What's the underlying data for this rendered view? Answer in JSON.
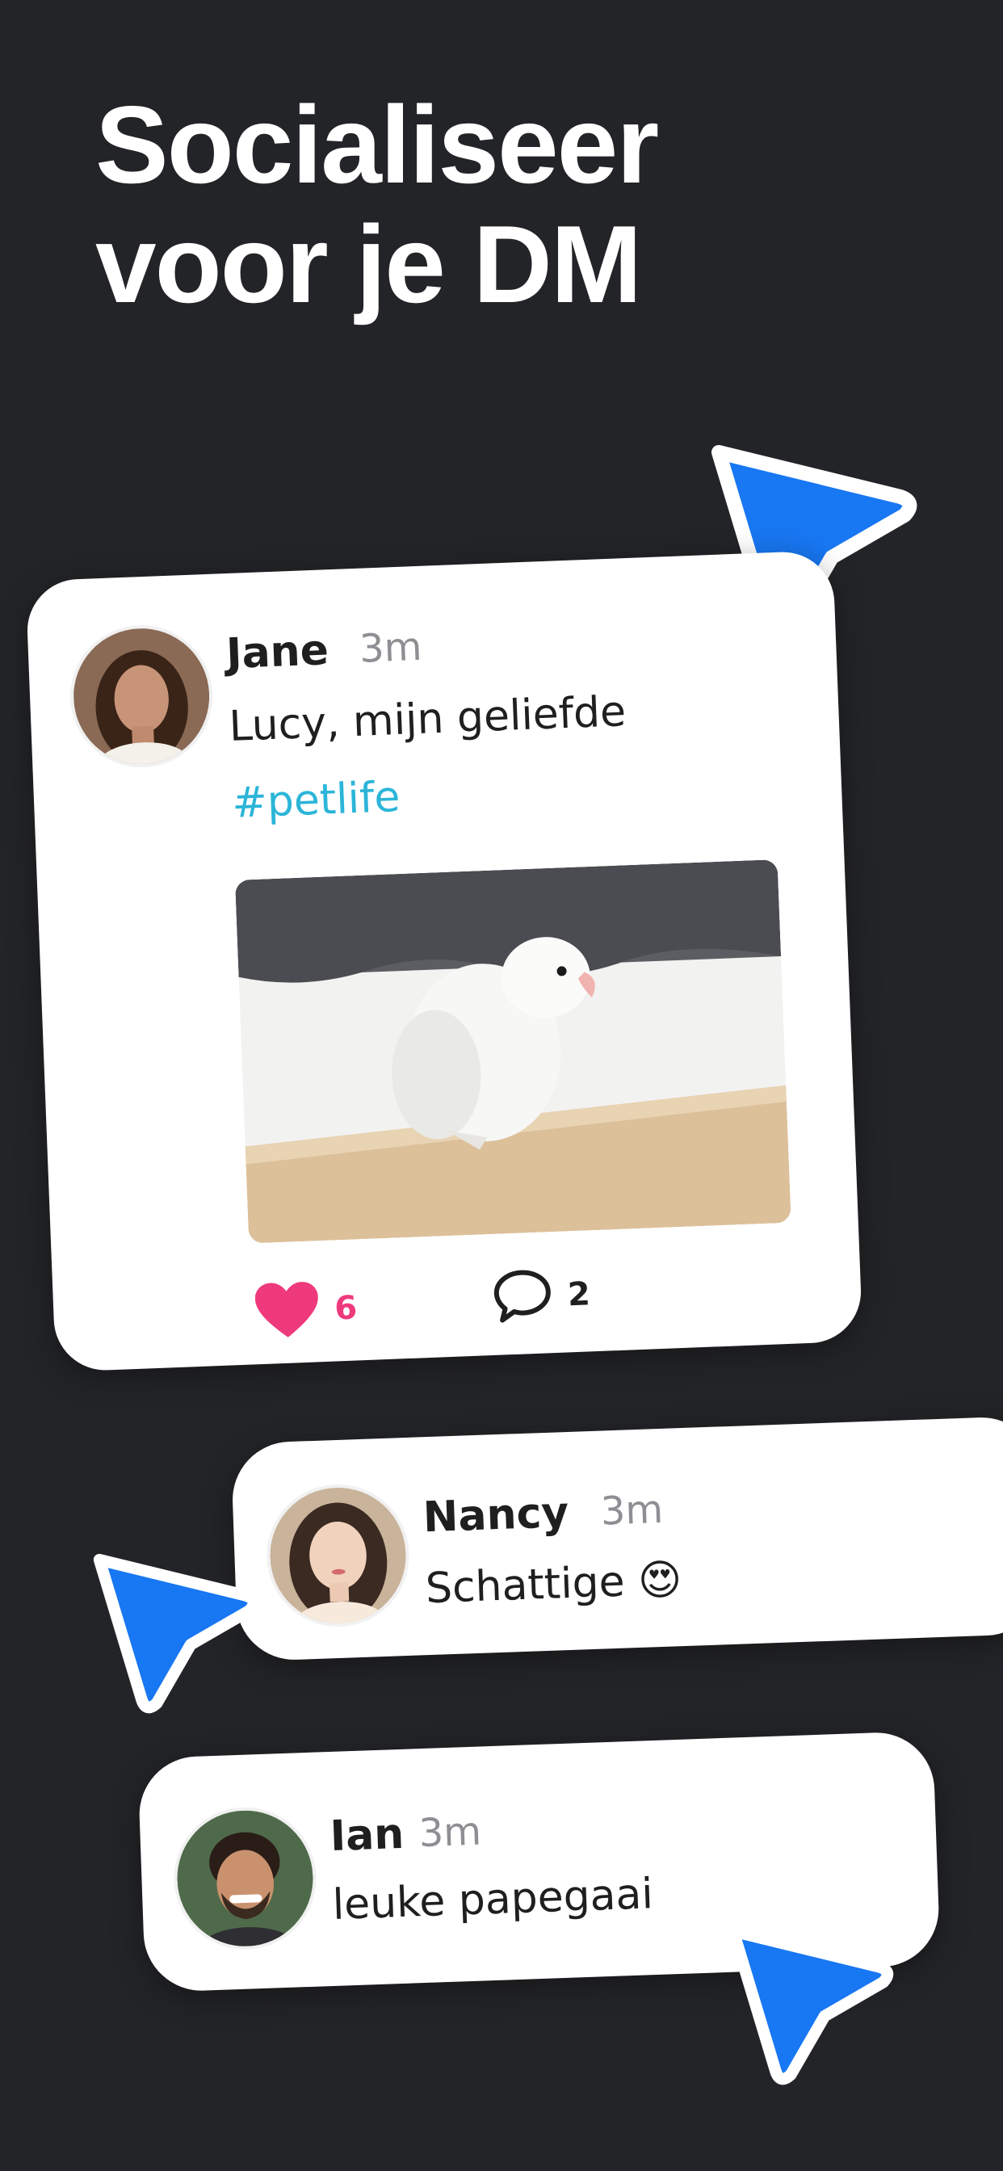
{
  "headline": {
    "line1": "Socialiseer",
    "line2": "voor je DM"
  },
  "post": {
    "author": "Jane",
    "time": "3m",
    "text": "Lucy, mijn geliefde",
    "hashtag": "#petlife",
    "photo_subject": "white parrot on wooden shelf",
    "likes": "6",
    "comments": "2",
    "like_icon": "heart-icon",
    "comment_icon": "speech-bubble-icon"
  },
  "comments": [
    {
      "author": "Nancy",
      "time": "3m",
      "text": "Schattige 😍"
    },
    {
      "author": "Ian",
      "time": "3m",
      "text": "leuke papegaai"
    }
  ],
  "colors": {
    "background": "#232427",
    "cursor": "#1877f2",
    "like": "#ee3a7c",
    "hashtag": "#2bb5d8"
  }
}
